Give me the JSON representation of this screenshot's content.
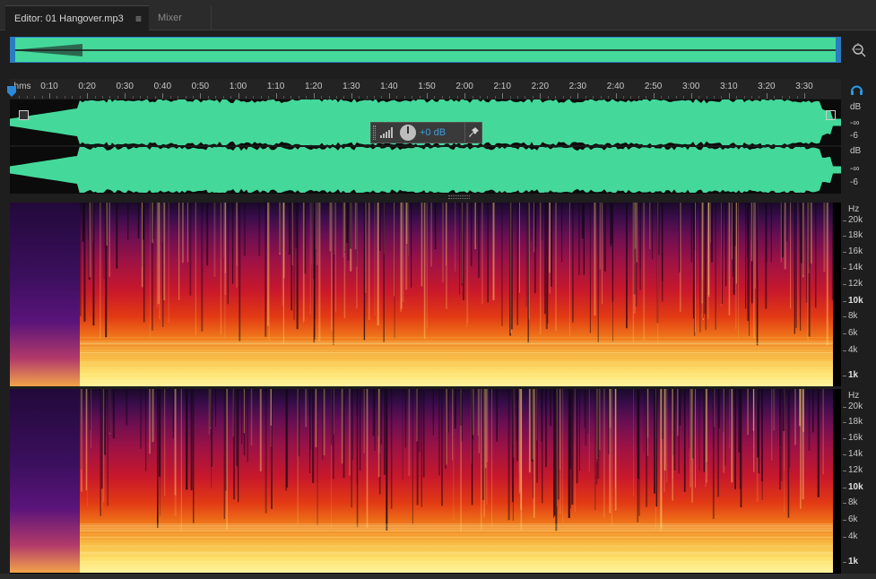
{
  "tabs": [
    {
      "label": "Editor: 01 Hangover.mp3",
      "active": true
    },
    {
      "label": "Mixer",
      "active": false
    }
  ],
  "tab_menu_glyph": "≡",
  "timeline": {
    "unit_label": "hms",
    "ticks": [
      "0:10",
      "0:20",
      "0:30",
      "0:40",
      "0:50",
      "1:00",
      "1:10",
      "1:20",
      "1:30",
      "1:40",
      "1:50",
      "2:00",
      "2:10",
      "2:20",
      "2:30",
      "2:40",
      "2:50",
      "3:00",
      "3:10",
      "3:20",
      "3:30",
      "3"
    ]
  },
  "hud": {
    "value": "+0 dB"
  },
  "db_ruler": {
    "channel1": {
      "unit": "dB",
      "inf": "-∞",
      "minus6": "-6"
    },
    "channel2": {
      "inf": "-∞",
      "minus6": "-6",
      "unit": "dB"
    }
  },
  "hz_ruler": {
    "unit": "Hz",
    "labels": [
      "20k",
      "18k",
      "16k",
      "14k",
      "12k",
      "10k",
      "8k",
      "6k",
      "4k",
      "1k"
    ]
  },
  "colors": {
    "waveform": "#44d99b",
    "accent": "#2a7bc0",
    "hud_value": "#3d9fe0"
  }
}
